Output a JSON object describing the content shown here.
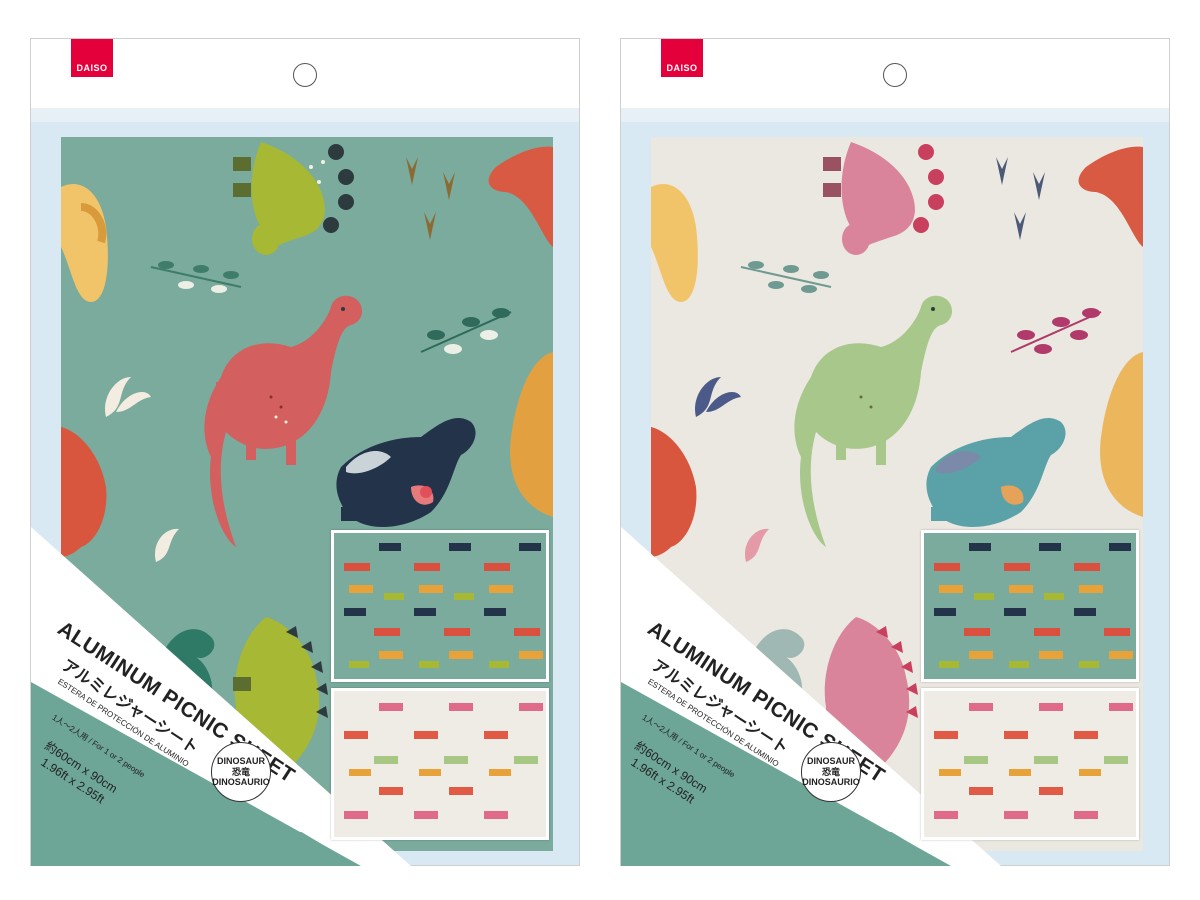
{
  "products": [
    {
      "id": "left",
      "brand": "DAISO",
      "background_color": "#7aab9d",
      "title": "ALUMINUM PICNIC SHEET",
      "japanese_title": "アルミレジャーシート",
      "subtitle": "ESTERA DE PROTECCIÓN DE ALUMINIO",
      "capacity": "1人〜2人用 / For 1 or 2 people",
      "size_metric": "約60cm x 90cm",
      "size_imperial": "1.96ft x 2.95ft",
      "badge_line1": "DINOSAUR",
      "badge_line2": "恐竜",
      "badge_line3": "DINOSAURIO",
      "swatches": [
        {
          "name": "green dinosaur pattern",
          "bg": "#7aab9d"
        },
        {
          "name": "cream dinosaur pattern",
          "bg": "#efece6"
        }
      ]
    },
    {
      "id": "right",
      "brand": "DAISO",
      "background_color": "#ebe7e1",
      "title": "ALUMINUM PICNIC SHEET",
      "japanese_title": "アルミレジャーシート",
      "subtitle": "ESTERA DE PROTECCIÓN DE ALUMINIO",
      "capacity": "1人〜2人用 / For 1 or 2 people",
      "size_metric": "約60cm x 90cm",
      "size_imperial": "1.96ft x 2.95ft",
      "badge_line1": "DINOSAUR",
      "badge_line2": "恐竜",
      "badge_line3": "DINOSAURIO",
      "swatches": [
        {
          "name": "green dinosaur pattern",
          "bg": "#7aab9d"
        },
        {
          "name": "cream dinosaur pattern",
          "bg": "#efece6"
        }
      ]
    }
  ]
}
